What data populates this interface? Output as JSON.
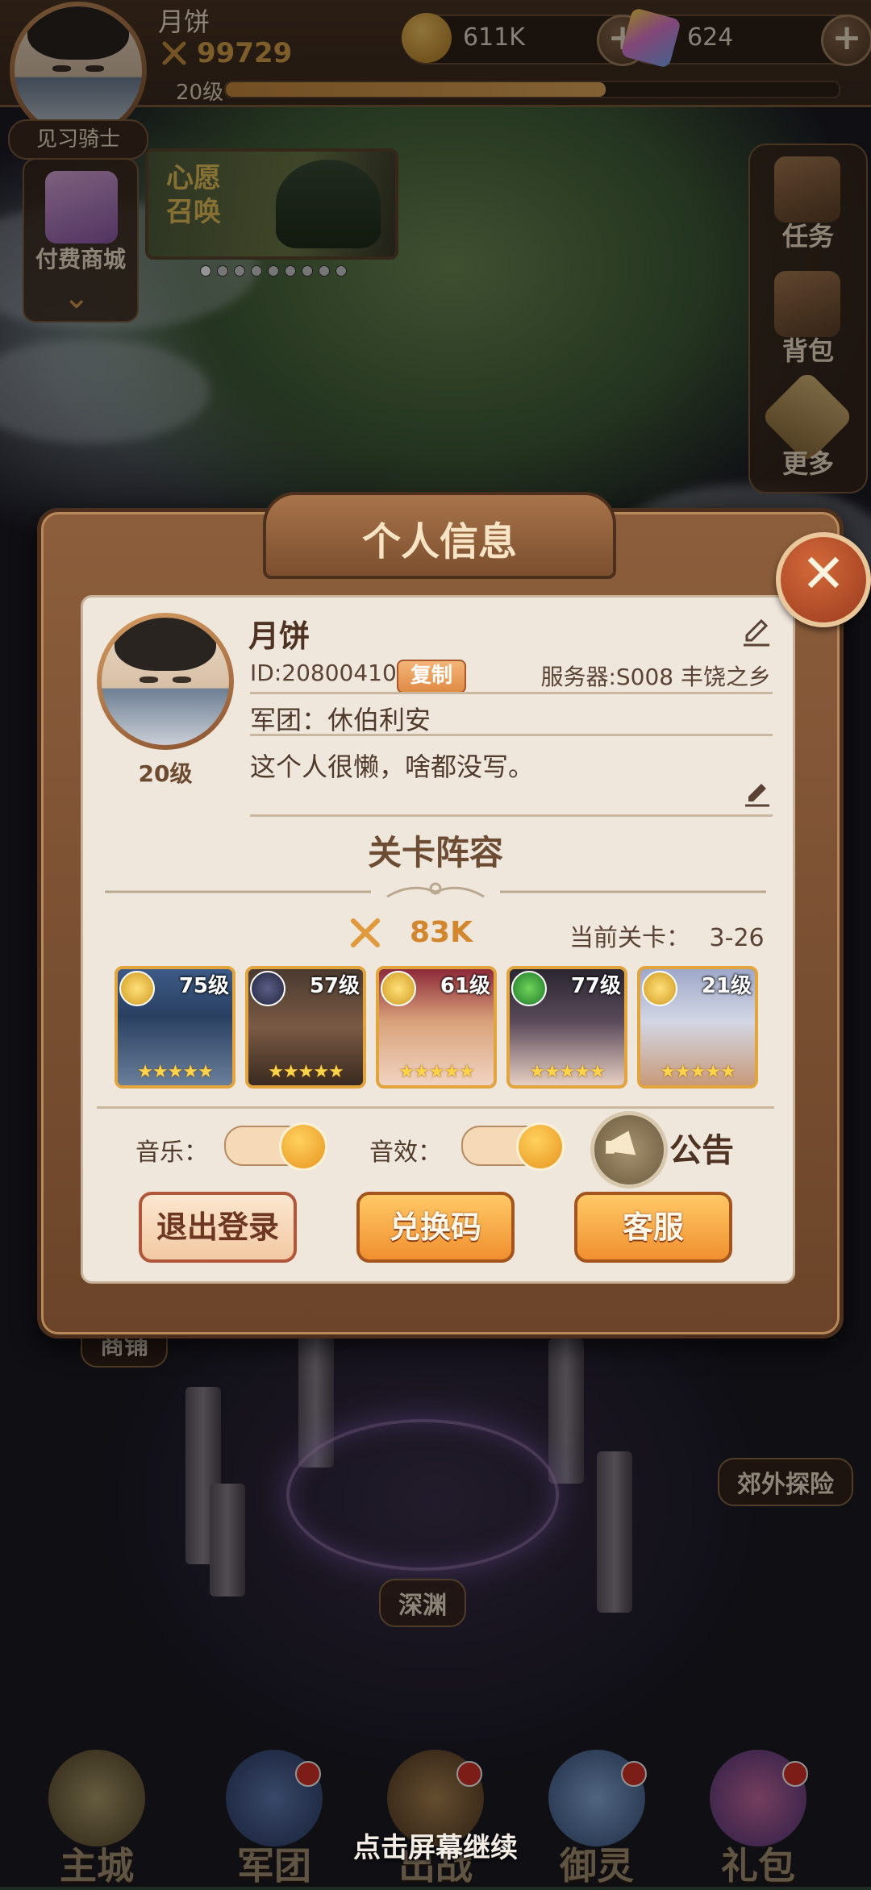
{
  "hud": {
    "player_name": "月饼",
    "power": "99729",
    "level": "20级",
    "xp_fraction": 0.62,
    "gold": "611K",
    "gems": "624",
    "title": "见习骑士"
  },
  "side_left": {
    "shop_label": "付费商城"
  },
  "banner": {
    "text": "心愿\n召唤",
    "page_count": 9,
    "active_page": 0
  },
  "side_right": {
    "items": [
      "任务",
      "背包",
      "更多"
    ]
  },
  "scene": {
    "shop": "商铺",
    "suburb": "郊外探险",
    "abyss": "深渊"
  },
  "modal": {
    "title": "个人信息",
    "name": "月饼",
    "id_text": "ID:20800410",
    "copy_label": "复制",
    "server": "服务器:S008 丰饶之乡",
    "guild": "军团：休伯利安",
    "signature": "这个人很懒，啥都没写。",
    "level": "20级",
    "lineup_title": "关卡阵容",
    "power": "83K",
    "stage_label": "当前关卡：",
    "stage_value": "3-26",
    "heroes": [
      {
        "level": "75级",
        "badge": "gold",
        "stars": 5
      },
      {
        "level": "57级",
        "badge": "dark",
        "stars": 5
      },
      {
        "level": "61级",
        "badge": "gold",
        "stars": 5
      },
      {
        "level": "77级",
        "badge": "green",
        "stars": 5
      },
      {
        "level": "21级",
        "badge": "gold",
        "stars": 5
      }
    ],
    "music_label": "音乐：",
    "music_on": true,
    "sfx_label": "音效：",
    "sfx_on": true,
    "notice_label": "公告",
    "logout": "退出登录",
    "redeem": "兑换码",
    "support": "客服"
  },
  "bottom_nav": [
    "主城",
    "军团",
    "出战",
    "御灵",
    "礼包"
  ],
  "continue_hint": "点击屏幕继续",
  "colors": {
    "accent": "#f08f2f",
    "frame": "#6b4429",
    "paper": "#efe7dc"
  }
}
